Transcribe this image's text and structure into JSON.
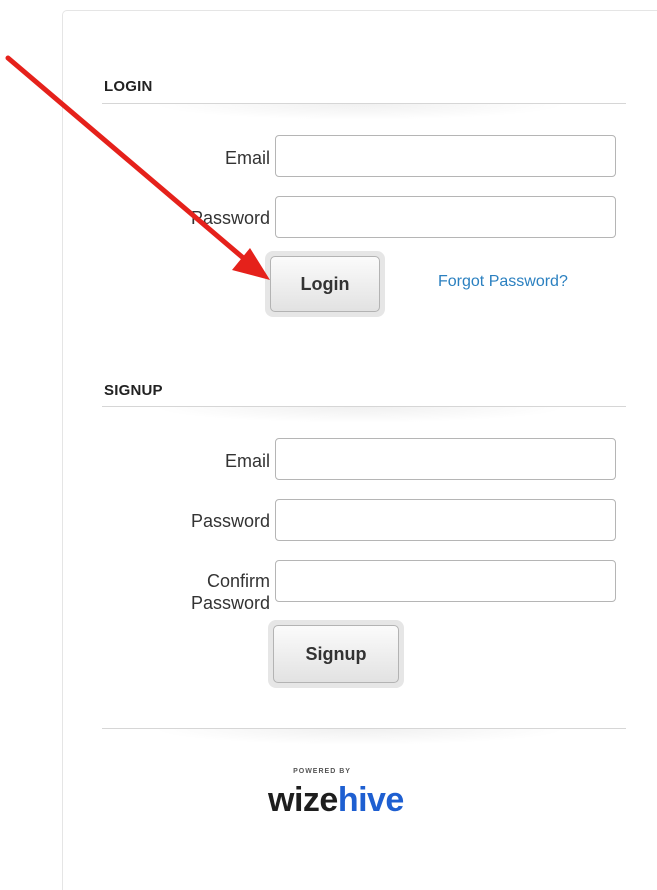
{
  "login": {
    "title": "LOGIN",
    "email_label": "Email",
    "email_value": "",
    "password_label": "Password",
    "password_value": "",
    "button_label": "Login",
    "forgot_label": "Forgot Password?"
  },
  "signup": {
    "title": "SIGNUP",
    "email_label": "Email",
    "email_value": "",
    "password_label": "Password",
    "password_value": "",
    "confirm_label_line1": "Confirm",
    "confirm_label_line2": "Password",
    "confirm_value": "",
    "button_label": "Signup"
  },
  "footer": {
    "powered_by": "POWERED BY",
    "logo_part1": "wize",
    "logo_part2": "hive"
  },
  "annotation": {
    "arrow_color": "#e5211b",
    "arrow_icon": "red-arrow-icon"
  },
  "colors": {
    "link": "#2b80c0",
    "logo_accent": "#1e5fd1"
  }
}
